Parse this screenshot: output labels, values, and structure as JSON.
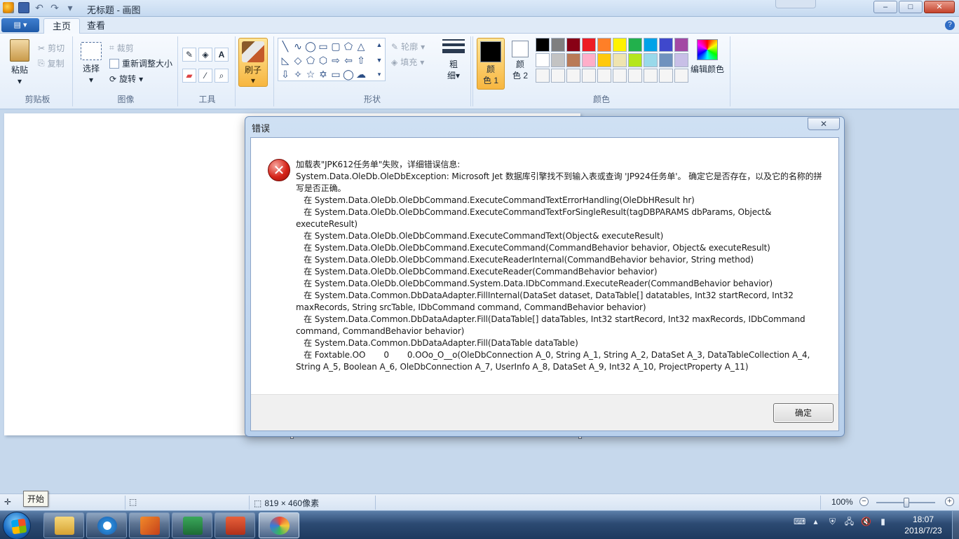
{
  "window": {
    "title": "无标题 - 画图",
    "minimize": "–",
    "maximize": "□",
    "close": "✕"
  },
  "ribbon": {
    "tabs": [
      {
        "label": "主页"
      },
      {
        "label": "查看"
      }
    ],
    "clipboard": {
      "paste": "粘贴",
      "cut": "剪切",
      "copy": "复制",
      "label": "剪贴板"
    },
    "image": {
      "select": "选择",
      "crop": "裁剪",
      "resize": "重新调整大小",
      "rotate": "旋转",
      "label": "图像"
    },
    "tools": {
      "label": "工具"
    },
    "brushes": {
      "label": "刷子"
    },
    "shapes": {
      "outline": "轮廓",
      "fill": "填充",
      "label": "形状"
    },
    "size": {
      "label_top": "粗",
      "label_bottom": "细"
    },
    "color1": {
      "top": "颜",
      "bottom": "色 1"
    },
    "color2": {
      "top": "颜",
      "bottom": "色 2"
    },
    "edit_colors": "编辑颜色",
    "colors_label": "颜色"
  },
  "colors": {
    "color1": "#000000",
    "color2": "#ffffff",
    "palette": [
      "#000000",
      "#7f7f7f",
      "#880015",
      "#ed1c24",
      "#ff7f27",
      "#fff200",
      "#22b14c",
      "#00a2e8",
      "#3f48cc",
      "#a349a4",
      "#ffffff",
      "#c3c3c3",
      "#b97a57",
      "#ffaec9",
      "#ffc90e",
      "#efe4b0",
      "#b5e61d",
      "#99d9ea",
      "#7092be",
      "#c8bfe7",
      "#f5f5f5",
      "#f5f5f5",
      "#f5f5f5",
      "#f5f5f5",
      "#f5f5f5",
      "#f5f5f5",
      "#f5f5f5",
      "#f5f5f5",
      "#f5f5f5",
      "#f5f5f5"
    ]
  },
  "dialog": {
    "title": "错误",
    "close": "✕",
    "message": "加载表\"JPK612任务单\"失败，详细错误信息:\nSystem.Data.OleDb.OleDbException: Microsoft Jet 数据库引擎找不到输入表或查询 'JP924任务单'。 确定它是否存在，以及它的名称的拼写是否正确。\n   在 System.Data.OleDb.OleDbCommand.ExecuteCommandTextErrorHandling(OleDbHResult hr)\n   在 System.Data.OleDb.OleDbCommand.ExecuteCommandTextForSingleResult(tagDBPARAMS dbParams, Object& executeResult)\n   在 System.Data.OleDb.OleDbCommand.ExecuteCommandText(Object& executeResult)\n   在 System.Data.OleDb.OleDbCommand.ExecuteCommand(CommandBehavior behavior, Object& executeResult)\n   在 System.Data.OleDb.OleDbCommand.ExecuteReaderInternal(CommandBehavior behavior, String method)\n   在 System.Data.OleDb.OleDbCommand.ExecuteReader(CommandBehavior behavior)\n   在 System.Data.OleDb.OleDbCommand.System.Data.IDbCommand.ExecuteReader(CommandBehavior behavior)\n   在 System.Data.Common.DbDataAdapter.FillInternal(DataSet dataset, DataTable[] datatables, Int32 startRecord, Int32 maxRecords, String srcTable, IDbCommand command, CommandBehavior behavior)\n   在 System.Data.Common.DbDataAdapter.Fill(DataTable[] dataTables, Int32 startRecord, Int32 maxRecords, IDbCommand command, CommandBehavior behavior)\n   在 System.Data.Common.DbDataAdapter.Fill(DataTable dataTable)\n   在 Foxtable.OO       0       0.OOo_O__o(OleDbConnection A_0, String A_1, String A_2, DataSet A_3, DataTableCollection A_4, String A_5, Boolean A_6, OleDbConnection A_7, UserInfo A_8, DataSet A_9, Int32 A_10, ProjectProperty A_11)",
    "ok": "确定"
  },
  "statusbar": {
    "tooltip": "开始",
    "dimensions": "819 × 460像素",
    "zoom": "100%"
  },
  "taskbar": {
    "time": "18:07",
    "date": "2018/7/23"
  }
}
